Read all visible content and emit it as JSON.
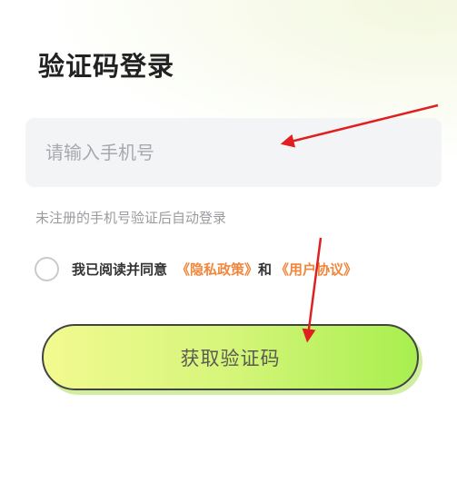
{
  "page": {
    "title": "验证码登录"
  },
  "phone_input": {
    "placeholder": "请输入手机号",
    "value": ""
  },
  "hint": "未注册的手机号验证后自动登录",
  "agreement": {
    "checked": false,
    "prefix": "我已阅读并同意",
    "privacy_link": "《隐私政策》",
    "conjunction": "和",
    "user_link": "《用户协议》"
  },
  "submit": {
    "label": "获取验证码"
  },
  "colors": {
    "link": "#f1863c",
    "button_gradient_start": "#f2fa90",
    "button_gradient_end": "#a8ef4f",
    "annotation_arrow": "#e02020"
  }
}
